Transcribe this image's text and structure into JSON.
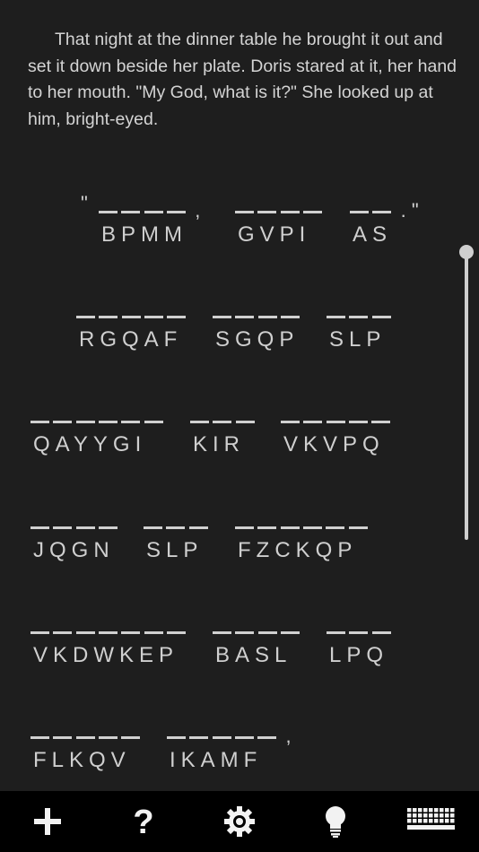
{
  "quote_text": "That night at the dinner table he brought it out and set it down beside her plate. Doris stared at it, her hand to her mouth. \"My God, what is it?\" She looked up at him, bright-eyed.",
  "puzzle": {
    "rows": [
      {
        "words": [
          {
            "letters": "BPMM",
            "pre": "\"",
            "post": ","
          },
          {
            "letters": "GVPI"
          },
          {
            "letters": "AS",
            "post": ". \""
          }
        ]
      },
      {
        "words": [
          {
            "letters": "RGQAF"
          },
          {
            "letters": "SGQP"
          },
          {
            "letters": "SLP"
          }
        ]
      },
      {
        "words": [
          {
            "letters": "QAYYGI"
          },
          {
            "letters": "KIR"
          },
          {
            "letters": "VKVPQ"
          }
        ]
      },
      {
        "words": [
          {
            "letters": "JQGN"
          },
          {
            "letters": "SLP"
          },
          {
            "letters": "FZCKQP"
          }
        ]
      },
      {
        "words": [
          {
            "letters": "VKDWKEP"
          },
          {
            "letters": "BASL"
          },
          {
            "letters": "LPQ"
          }
        ]
      },
      {
        "words": [
          {
            "letters": "FLKQV"
          },
          {
            "letters": "IKAMF",
            "post": ","
          }
        ]
      }
    ]
  },
  "toolbar": {
    "items": [
      {
        "name": "add-icon",
        "glyph": "+"
      },
      {
        "name": "help-icon",
        "glyph": "?"
      },
      {
        "name": "settings-gear-icon",
        "glyph": "⚙"
      },
      {
        "name": "hint-lightbulb-icon",
        "glyph": "💡"
      },
      {
        "name": "keyboard-icon",
        "glyph": "⌨"
      }
    ]
  }
}
